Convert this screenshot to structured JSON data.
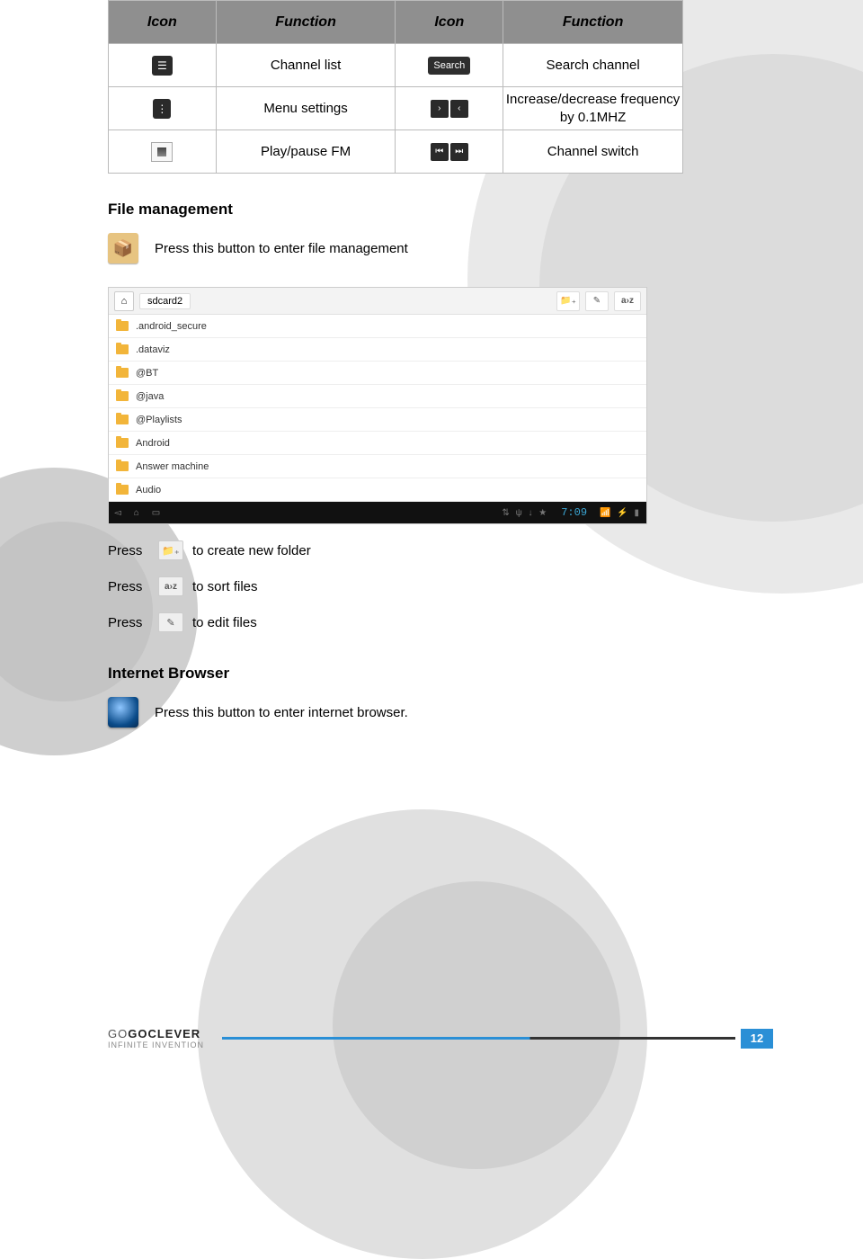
{
  "table": {
    "headers": [
      "Icon",
      "Function",
      "Icon",
      "Function"
    ],
    "rows": [
      {
        "f1": "Channel list",
        "f2": "Search channel"
      },
      {
        "f1": "Menu settings",
        "f2": "Increase/decrease frequency by 0.1MHZ"
      },
      {
        "f1": "Play/pause FM",
        "f2": "Channel switch"
      }
    ],
    "search_label": "Search"
  },
  "sections": {
    "file_mgmt": "File management",
    "file_mgmt_instr": "Press this button  to enter file management",
    "internet": "Internet Browser",
    "internet_instr": "Press this button to enter internet browser."
  },
  "shot": {
    "crumb": "sdcard2",
    "az": "a›z",
    "items": [
      ".android_secure",
      ".dataviz",
      "@BT",
      "@java",
      "@Playlists",
      "Android",
      "Answer machine",
      "Audio"
    ],
    "time": "7:09"
  },
  "press": {
    "label": "Press",
    "newfolder": "to create new folder",
    "sort": "to sort files",
    "edit": "to edit files",
    "az": "a›z"
  },
  "footer": {
    "logo1": "GO",
    "logo2": "GOCLEVER",
    "tag": "INFINITE INVENTION",
    "page": "12"
  }
}
